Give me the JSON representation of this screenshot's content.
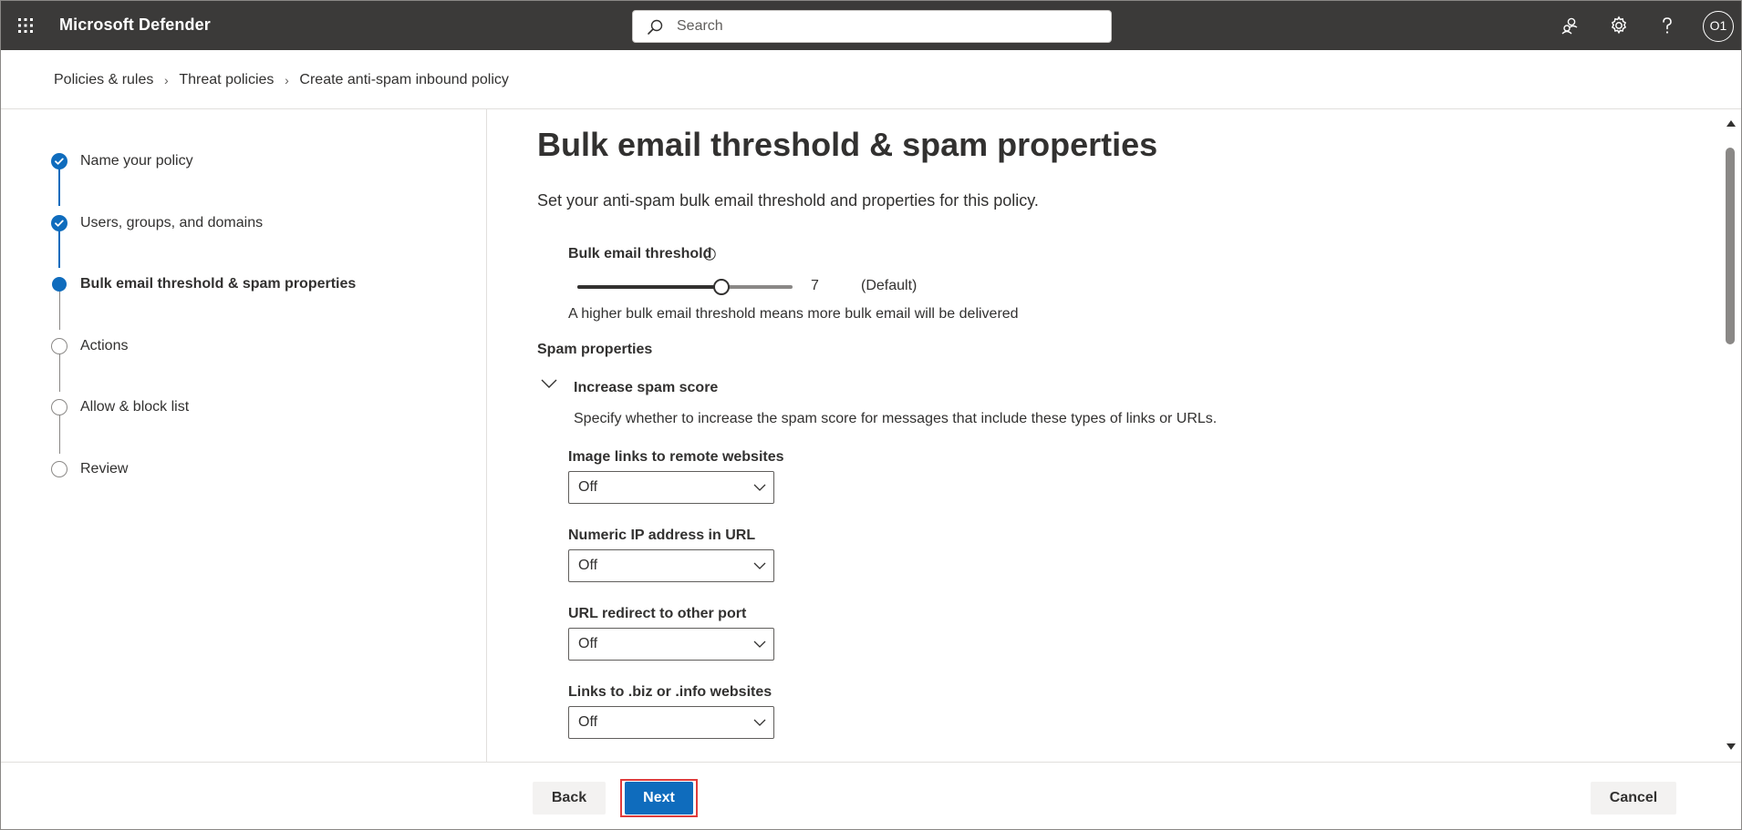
{
  "app": {
    "title": "Microsoft Defender",
    "search_placeholder": "Search",
    "avatar_initials": "O1"
  },
  "breadcrumb": [
    "Policies & rules",
    "Threat policies",
    "Create anti-spam inbound policy"
  ],
  "steps": [
    {
      "label": "Name your policy",
      "state": "done"
    },
    {
      "label": "Users, groups, and domains",
      "state": "done"
    },
    {
      "label": "Bulk email threshold & spam properties",
      "state": "current"
    },
    {
      "label": "Actions",
      "state": "todo"
    },
    {
      "label": "Allow & block list",
      "state": "todo"
    },
    {
      "label": "Review",
      "state": "todo"
    }
  ],
  "main": {
    "title": "Bulk email threshold & spam properties",
    "description": "Set your anti-spam bulk email threshold and properties for this policy.",
    "bulk_threshold": {
      "label": "Bulk email threshold",
      "value": "7",
      "value_fraction": 0.67,
      "default_note": "(Default)",
      "help": "A higher bulk email threshold means more bulk email will be delivered"
    },
    "spam_properties_label": "Spam properties",
    "increase_spam_score": {
      "title": "Increase spam score",
      "description": "Specify whether to increase the spam score for messages that include these types of links or URLs.",
      "fields": [
        {
          "label": "Image links to remote websites",
          "value": "Off"
        },
        {
          "label": "Numeric IP address in URL",
          "value": "Off"
        },
        {
          "label": "URL redirect to other port",
          "value": "Off"
        },
        {
          "label": "Links to .biz or .info websites",
          "value": "Off"
        }
      ]
    }
  },
  "footer": {
    "back_label": "Back",
    "next_label": "Next",
    "cancel_label": "Cancel"
  },
  "colors": {
    "topbar": "#3b3a39",
    "accent": "#0f6cbd",
    "highlight": "#e03c3c"
  }
}
